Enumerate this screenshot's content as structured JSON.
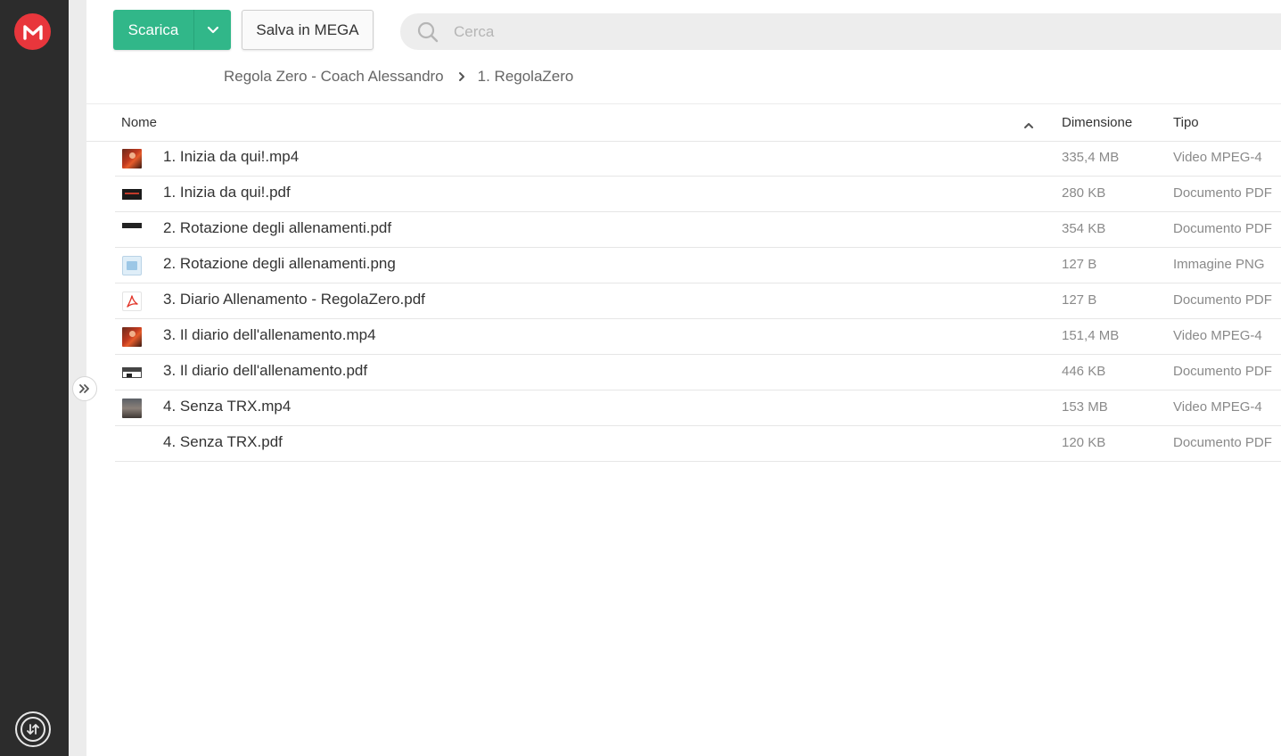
{
  "toolbar": {
    "download_label": "Scarica",
    "save_label": "Salva in MEGA",
    "search_placeholder": "Cerca"
  },
  "breadcrumb": {
    "items": [
      "Regola Zero - Coach Alessandro",
      "1. RegolaZero"
    ]
  },
  "table": {
    "columns": {
      "name": "Nome",
      "size": "Dimensione",
      "type": "Tipo"
    },
    "sort": "ascending",
    "rows": [
      {
        "name": "1. Inizia da qui!.mp4",
        "size": "335,4 MB",
        "type": "Video MPEG-4",
        "thumb": "video-thumbnail"
      },
      {
        "name": "1. Inizia da qui!.pdf",
        "size": "280 KB",
        "type": "Documento PDF",
        "thumb": "pdf-thumbnail"
      },
      {
        "name": "2. Rotazione degli allenamenti.pdf",
        "size": "354 KB",
        "type": "Documento PDF",
        "thumb": "pdf-thumbnail"
      },
      {
        "name": "2. Rotazione degli allenamenti.png",
        "size": "127 B",
        "type": "Immagine PNG",
        "thumb": "image-file-icon"
      },
      {
        "name": "3. Diario Allenamento - RegolaZero.pdf",
        "size": "127 B",
        "type": "Documento PDF",
        "thumb": "pdf-file-icon"
      },
      {
        "name": "3. Il diario dell'allenamento.mp4",
        "size": "151,4 MB",
        "type": "Video MPEG-4",
        "thumb": "video-thumbnail"
      },
      {
        "name": "3. Il diario dell'allenamento.pdf",
        "size": "446 KB",
        "type": "Documento PDF",
        "thumb": "pdf-thumbnail"
      },
      {
        "name": "4. Senza TRX.mp4",
        "size": "153 MB",
        "type": "Video MPEG-4",
        "thumb": "video-thumbnail"
      },
      {
        "name": "4. Senza TRX.pdf",
        "size": "120 KB",
        "type": "Documento PDF",
        "thumb": "none"
      }
    ]
  },
  "colors": {
    "accent": "#31b789",
    "brand": "#e8363c",
    "rail": "#2c2c2c"
  },
  "icons": [
    "mega-logo-icon",
    "chevron-down-icon",
    "search-icon",
    "chevron-right-icon",
    "sort-up-icon",
    "expand-sidebar-icon",
    "transfers-icon"
  ]
}
